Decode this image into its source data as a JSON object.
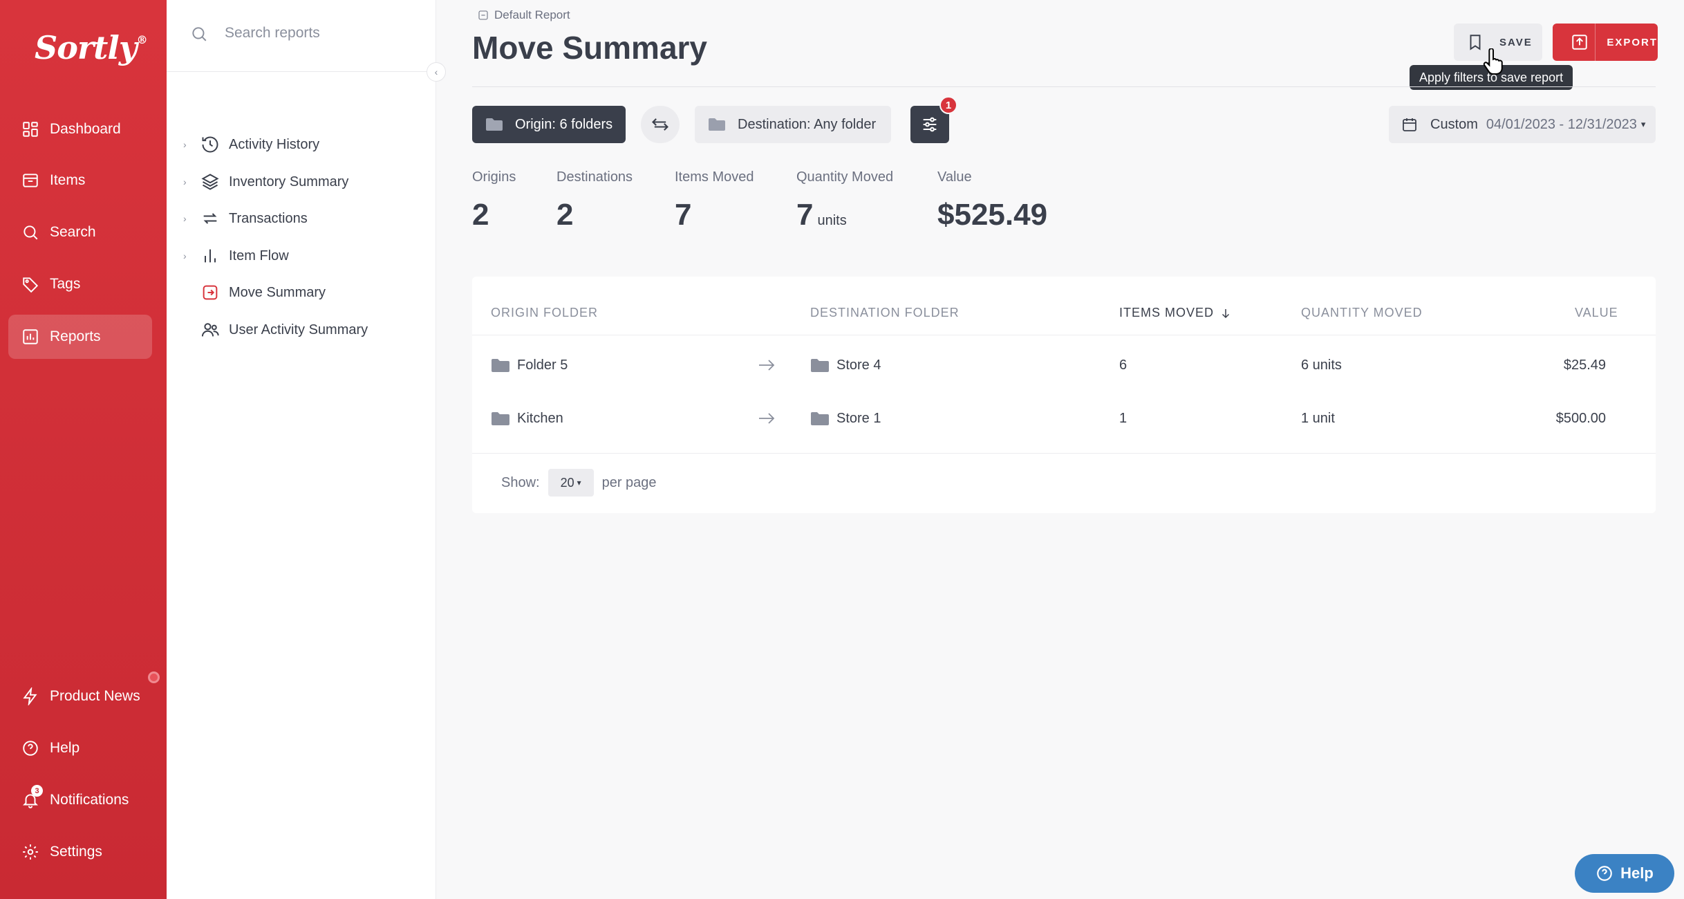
{
  "brand": {
    "name": "Sortly",
    "mark": "®"
  },
  "nav": {
    "dashboard": "Dashboard",
    "items": "Items",
    "search": "Search",
    "tags": "Tags",
    "reports": "Reports",
    "product_news": "Product News",
    "help": "Help",
    "notifications": "Notifications",
    "notifications_count": "3",
    "settings": "Settings"
  },
  "reports_panel": {
    "search_placeholder": "Search reports",
    "items": [
      {
        "label": "Activity History",
        "expandable": true
      },
      {
        "label": "Inventory Summary",
        "expandable": true
      },
      {
        "label": "Transactions",
        "expandable": true
      },
      {
        "label": "Item Flow",
        "expandable": true
      },
      {
        "label": "Move Summary",
        "expandable": false,
        "active": true
      },
      {
        "label": "User Activity Summary",
        "expandable": false
      }
    ]
  },
  "header": {
    "breadcrumb": "Default Report",
    "title": "Move Summary",
    "save_label": "SAVE",
    "export_label": "EXPORT",
    "tooltip": "Apply filters to save report"
  },
  "filters": {
    "origin": "Origin: 6 folders",
    "destination": "Destination: Any folder",
    "advanced_count": "1",
    "date_label": "Custom",
    "date_range": "04/01/2023 - 12/31/2023"
  },
  "stats": {
    "origins": {
      "label": "Origins",
      "value": "2"
    },
    "destinations": {
      "label": "Destinations",
      "value": "2"
    },
    "items_moved": {
      "label": "Items Moved",
      "value": "7"
    },
    "quantity_moved": {
      "label": "Quantity Moved",
      "value": "7",
      "unit": "units"
    },
    "value": {
      "label": "Value",
      "value": "$525.49"
    }
  },
  "table": {
    "headers": {
      "origin": "ORIGIN FOLDER",
      "destination": "DESTINATION FOLDER",
      "items_moved": "ITEMS MOVED",
      "quantity_moved": "QUANTITY MOVED",
      "value": "VALUE"
    },
    "rows": [
      {
        "origin": "Folder 5",
        "destination": "Store 4",
        "items_moved": "6",
        "quantity_moved": "6 units",
        "value": "$25.49"
      },
      {
        "origin": "Kitchen",
        "destination": "Store 1",
        "items_moved": "1",
        "quantity_moved": "1 unit",
        "value": "$500.00"
      }
    ],
    "show_label": "Show:",
    "per_page_value": "20",
    "per_page_label": "per page"
  },
  "help_widget": "Help",
  "colors": {
    "brand_red": "#d8343c",
    "dark": "#3a3f4b",
    "help_blue": "#3b82c4"
  }
}
